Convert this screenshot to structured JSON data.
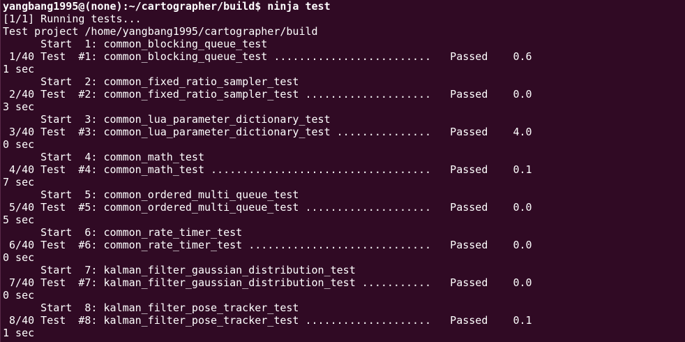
{
  "terminal": {
    "lines": [
      "yangbang1995@(none):~/cartographer/build$ ninja test",
      "[1/1] Running tests...",
      "Test project /home/yangbang1995/cartographer/build",
      "      Start  1: common_blocking_queue_test",
      " 1/40 Test  #1: common_blocking_queue_test .........................   Passed    0.6",
      "1 sec",
      "      Start  2: common_fixed_ratio_sampler_test",
      " 2/40 Test  #2: common_fixed_ratio_sampler_test ....................   Passed    0.0",
      "3 sec",
      "      Start  3: common_lua_parameter_dictionary_test",
      " 3/40 Test  #3: common_lua_parameter_dictionary_test ...............   Passed    4.0",
      "0 sec",
      "      Start  4: common_math_test",
      " 4/40 Test  #4: common_math_test ...................................   Passed    0.1",
      "7 sec",
      "      Start  5: common_ordered_multi_queue_test",
      " 5/40 Test  #5: common_ordered_multi_queue_test ....................   Passed    0.0",
      "5 sec",
      "      Start  6: common_rate_timer_test",
      " 6/40 Test  #6: common_rate_timer_test .............................   Passed    0.0",
      "0 sec",
      "      Start  7: kalman_filter_gaussian_distribution_test",
      " 7/40 Test  #7: kalman_filter_gaussian_distribution_test ...........   Passed    0.0",
      "0 sec",
      "      Start  8: kalman_filter_pose_tracker_test",
      " 8/40 Test  #8: kalman_filter_pose_tracker_test ....................   Passed    0.1",
      "1 sec"
    ],
    "colors": {
      "background": "#300a24",
      "foreground": "#ffffff"
    }
  }
}
